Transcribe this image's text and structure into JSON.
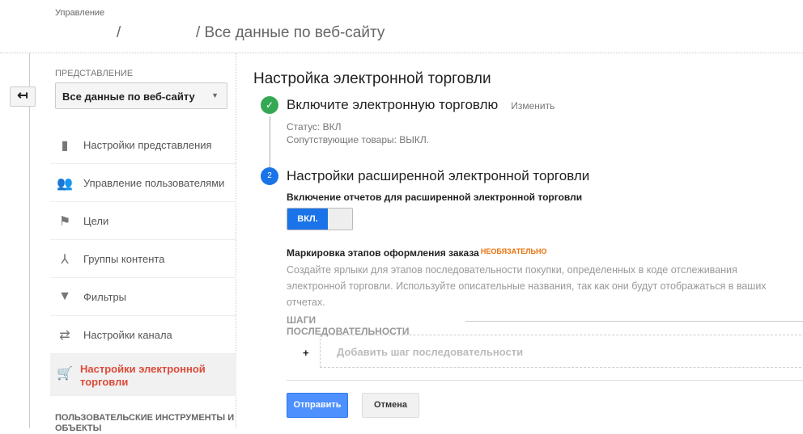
{
  "header": {
    "section": "Управление",
    "sep1": "/",
    "crumb": "/ Все данные по веб-сайту"
  },
  "sidebar": {
    "view_label": "ПРЕДСТАВЛЕНИЕ",
    "view_select": "Все данные по веб-сайту",
    "items": [
      {
        "label": "Настройки представления",
        "icon": "document-icon"
      },
      {
        "label": "Управление пользователями",
        "icon": "users-icon"
      },
      {
        "label": "Цели",
        "icon": "flag-icon"
      },
      {
        "label": "Группы контента",
        "icon": "content-groups-icon"
      },
      {
        "label": "Фильтры",
        "icon": "filter-icon"
      },
      {
        "label": "Настройки канала",
        "icon": "channel-icon"
      },
      {
        "label": "Настройки электронной торговли",
        "icon": "cart-icon"
      }
    ],
    "footer": "ПОЛЬЗОВАТЕЛЬСКИЕ ИНСТРУМЕНТЫ И ОБЪЕКТЫ"
  },
  "main": {
    "title": "Настройка электронной торговли",
    "step1": {
      "title": "Включите электронную торговлю",
      "change": "Изменить",
      "status": "Статус: ВКЛ",
      "related": "Сопутствующие товары: ВЫКЛ."
    },
    "step2": {
      "number": "2",
      "title": "Настройки расширенной электронной торговли",
      "enable_label": "Включение отчетов для расширенной электронной торговли",
      "toggle": "ВКЛ.",
      "checkout_label": "Маркировка этапов оформления заказа",
      "optional": "НЕОБЯЗАТЕЛЬНО",
      "description": "Создайте ярлыки для этапов последовательности покупки, определенных в коде отслеживания электронной торговли. Используйте описательные названия, так как они будут отображаться в ваших отчетах.",
      "steps_header": "ШАГИ ПОСЛЕДОВАТЕЛЬНОСТИ",
      "add_plus": "+",
      "add_step": "Добавить шаг последовательности"
    },
    "submit": "Отправить",
    "cancel": "Отмена"
  },
  "colors": {
    "accent": "#1a73e8",
    "active": "#dd4b39",
    "optional": "#e8710a",
    "success": "#34a853"
  }
}
